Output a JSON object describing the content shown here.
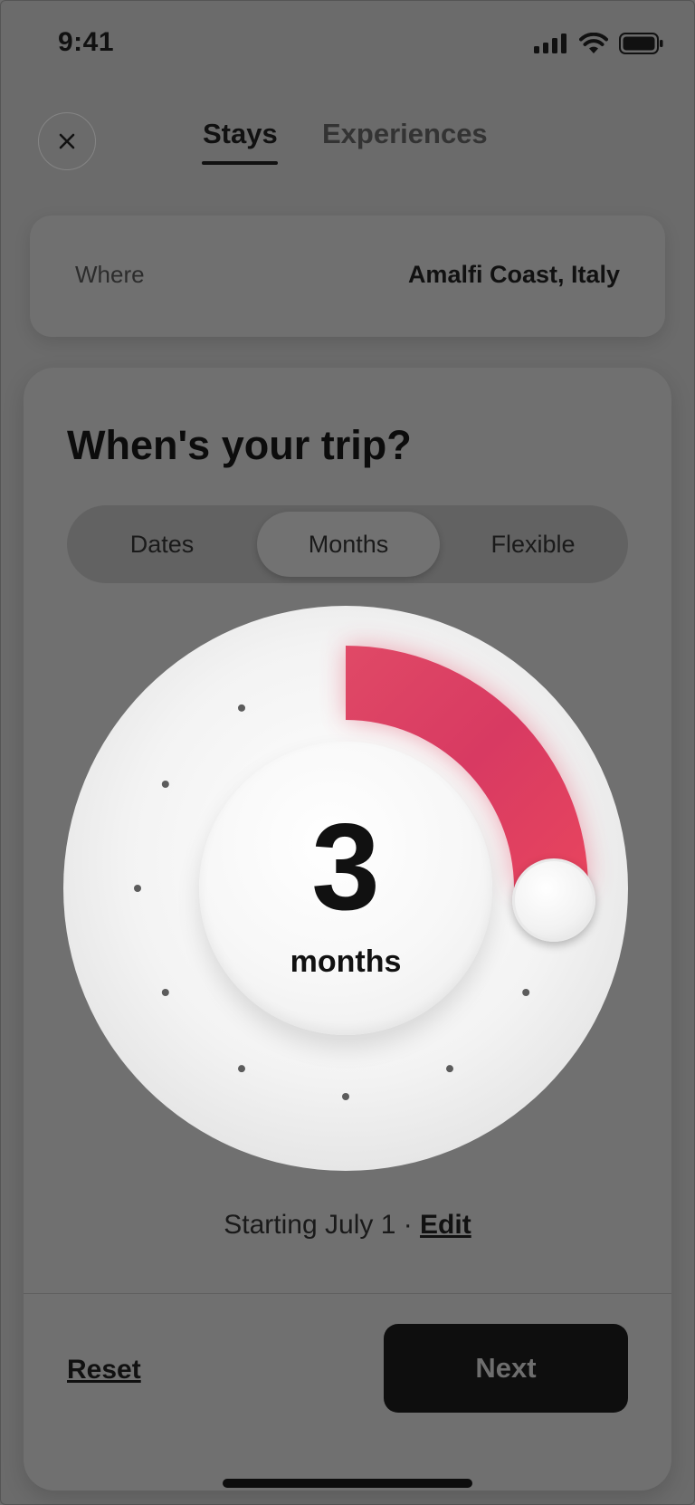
{
  "status_bar": {
    "time": "9:41",
    "icons": [
      "cellular-signal-icon",
      "wifi-icon",
      "battery-icon"
    ]
  },
  "header": {
    "close_icon": "close-icon",
    "tabs": [
      {
        "label": "Stays",
        "active": true
      },
      {
        "label": "Experiences",
        "active": false
      }
    ]
  },
  "where": {
    "label": "Where",
    "value": "Amalfi Coast, Italy"
  },
  "trip": {
    "question": "When's your trip?",
    "segments": [
      {
        "label": "Dates",
        "selected": false
      },
      {
        "label": "Months",
        "selected": true
      },
      {
        "label": "Flexible",
        "selected": false
      }
    ],
    "dial": {
      "value": "3",
      "unit": "months",
      "max_months": 12,
      "selected_months": 3
    },
    "starting_text": "Starting July 1 · ",
    "edit_label": "Edit"
  },
  "footer": {
    "reset_label": "Reset",
    "next_label": "Next"
  },
  "colors": {
    "accent": "#e3425f",
    "overlay": "#6b6b6b"
  }
}
